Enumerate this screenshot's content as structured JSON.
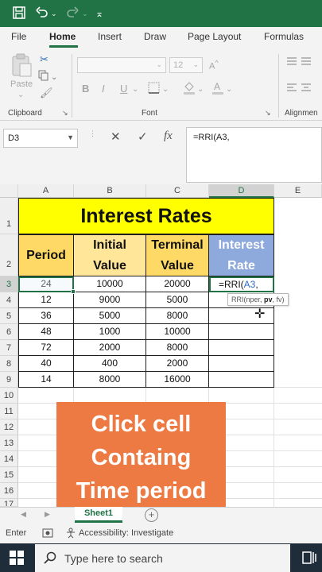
{
  "titlebar": {
    "icons": [
      "save-icon",
      "undo-icon",
      "redo-icon",
      "customize-icon"
    ]
  },
  "ribbon_tabs": [
    "File",
    "Home",
    "Insert",
    "Draw",
    "Page Layout",
    "Formulas"
  ],
  "active_tab": "Home",
  "ribbon": {
    "paste_label": "Paste",
    "clipboard_label": "Clipboard",
    "font_label": "Font",
    "alignment_label": "Alignmen",
    "font_size": "12",
    "bold": "B",
    "italic": "I",
    "underline": "U"
  },
  "formula_bar": {
    "name_box": "D3",
    "cancel_symbol": "✕",
    "enter_symbol": "✓",
    "fx_symbol": "fx",
    "content": "=RRI(A3,"
  },
  "columns": [
    "A",
    "B",
    "C",
    "D",
    "E"
  ],
  "rows": [
    "1",
    "2",
    "3",
    "4",
    "5",
    "6",
    "7",
    "8",
    "9",
    "10",
    "11",
    "12",
    "13",
    "14",
    "15",
    "16",
    "17"
  ],
  "table": {
    "title": "Interest Rates",
    "headers": [
      [
        "Period"
      ],
      [
        "Initial",
        "Value"
      ],
      [
        "Terminal",
        "Value"
      ],
      [
        "Interest",
        "Rate"
      ]
    ],
    "data": [
      [
        "24",
        "10000",
        "20000"
      ],
      [
        "12",
        "9000",
        "5000"
      ],
      [
        "36",
        "5000",
        "8000"
      ],
      [
        "48",
        "1000",
        "10000"
      ],
      [
        "72",
        "2000",
        "8000"
      ],
      [
        "40",
        "400",
        "2000"
      ],
      [
        "14",
        "8000",
        "16000"
      ]
    ]
  },
  "active_cell": "D3",
  "cell_edit": {
    "prefix": "=RRI(",
    "ref": "A3",
    "suffix": ","
  },
  "tooltip": {
    "pre": "RRI(nper, ",
    "bold": "pv",
    "post": ", fv)"
  },
  "overlay": {
    "lines": [
      "Click cell",
      "Containg",
      "Time period"
    ]
  },
  "sheet_tab": "Sheet1",
  "status": {
    "mode": "Enter",
    "accessibility": "Accessibility: Investigate"
  },
  "taskbar": {
    "search_placeholder": "Type here to search"
  },
  "colors": {
    "excel_green": "#217346",
    "title_fill": "#ffff00",
    "header_fill_a": "#ffd966",
    "header_fill_b": "#ffe699",
    "header_fill_d": "#8ea9db",
    "overlay": "#ee7a43",
    "taskbar": "#1f2d3a"
  }
}
